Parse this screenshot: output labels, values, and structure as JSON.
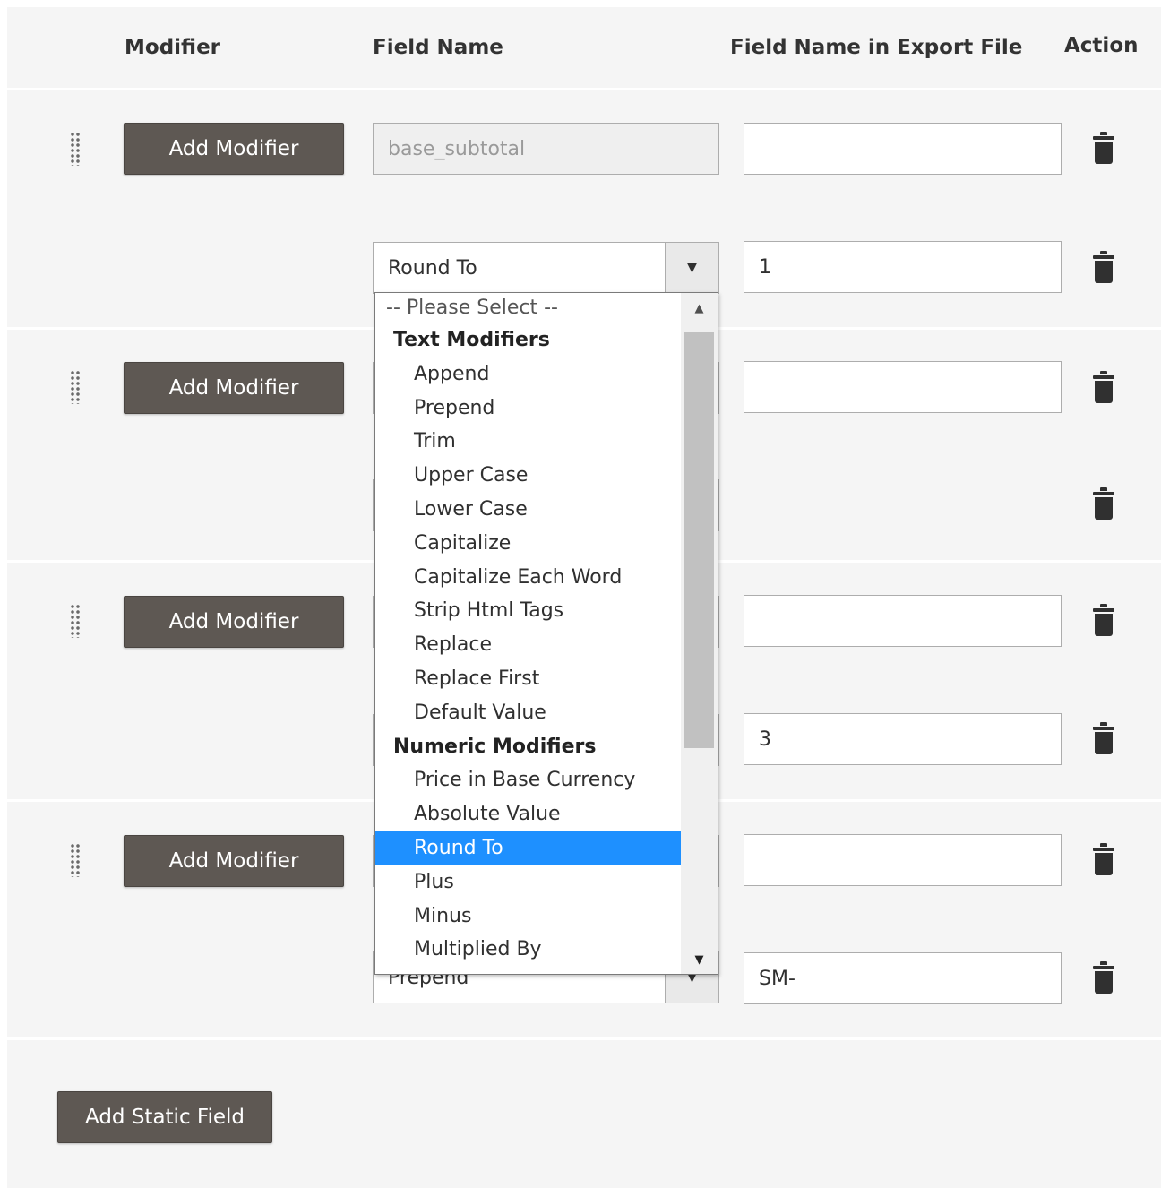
{
  "header": {
    "modifier": "Modifier",
    "field_name": "Field Name",
    "export_name": "Field Name in Export File",
    "action": "Action"
  },
  "buttons": {
    "add_modifier": "Add Modifier",
    "add_static_field": "Add Static Field"
  },
  "rows": [
    {
      "field": "base_subtotal",
      "export": "",
      "modifier_select": "Round To",
      "modifier_value": "1"
    },
    {
      "field": "",
      "export": "",
      "modifier_select": "",
      "modifier_value": ""
    },
    {
      "field": "",
      "export": "",
      "modifier_select": "",
      "modifier_value": "3"
    },
    {
      "field": "",
      "export": "",
      "modifier_select": "Prepend",
      "modifier_value": "SM-"
    }
  ],
  "dropdown": {
    "placeholder": "-- Please Select --",
    "groups": [
      {
        "label": "Text Modifiers",
        "items": [
          "Append",
          "Prepend",
          "Trim",
          "Upper Case",
          "Lower Case",
          "Capitalize",
          "Capitalize Each Word",
          "Strip Html Tags",
          "Replace",
          "Replace First",
          "Default Value"
        ]
      },
      {
        "label": "Numeric Modifiers",
        "items": [
          "Price in Base Currency",
          "Absolute Value",
          "Round To",
          "Plus",
          "Minus",
          "Multiplied By"
        ]
      }
    ],
    "selected": "Round To"
  },
  "colors": {
    "button_bg": "#5e5853",
    "panel_bg": "#f5f5f5",
    "selected_bg": "#1e90ff"
  },
  "icons": {
    "drag": "drag-handle-icon",
    "delete": "trash-icon",
    "select_arrow": "chevron-down-icon"
  }
}
